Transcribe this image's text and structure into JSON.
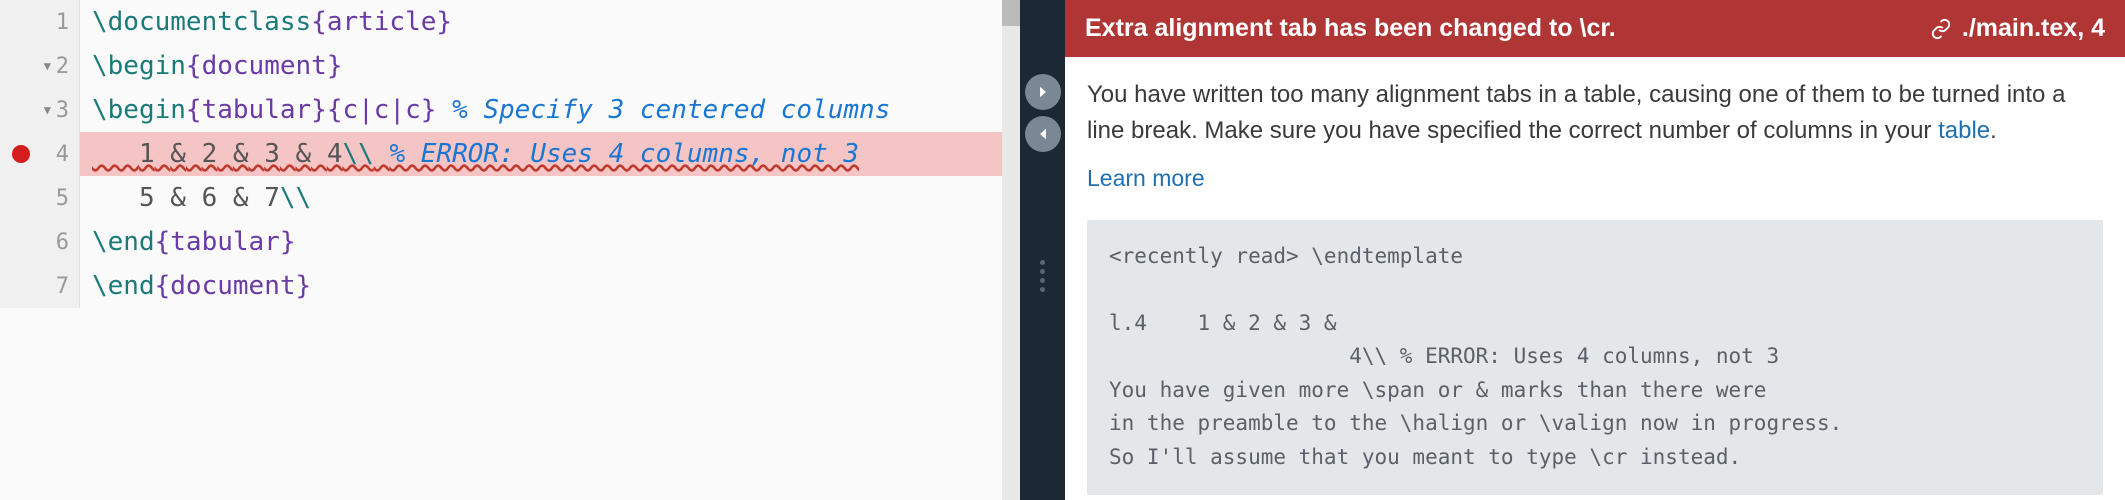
{
  "editor": {
    "lines": [
      {
        "n": "1",
        "fold": false,
        "error": false,
        "highlight": false,
        "tokens": [
          {
            "cls": "tok-cmd",
            "t": "\\documentclass"
          },
          {
            "cls": "tok-brace",
            "t": "{"
          },
          {
            "cls": "tok-arg",
            "t": "article"
          },
          {
            "cls": "tok-brace",
            "t": "}"
          }
        ]
      },
      {
        "n": "2",
        "fold": true,
        "error": false,
        "highlight": false,
        "tokens": [
          {
            "cls": "tok-cmd",
            "t": "\\begin"
          },
          {
            "cls": "tok-brace",
            "t": "{"
          },
          {
            "cls": "tok-arg",
            "t": "document"
          },
          {
            "cls": "tok-brace",
            "t": "}"
          }
        ]
      },
      {
        "n": "3",
        "fold": true,
        "error": false,
        "highlight": false,
        "tokens": [
          {
            "cls": "tok-cmd",
            "t": "\\begin"
          },
          {
            "cls": "tok-brace",
            "t": "{"
          },
          {
            "cls": "tok-arg",
            "t": "tabular"
          },
          {
            "cls": "tok-brace",
            "t": "}"
          },
          {
            "cls": "tok-brace",
            "t": "{"
          },
          {
            "cls": "tok-arg",
            "t": "c|c|c"
          },
          {
            "cls": "tok-brace",
            "t": "}"
          },
          {
            "cls": "",
            "t": " "
          },
          {
            "cls": "tok-comment",
            "t": "% Specify 3 centered columns"
          }
        ]
      },
      {
        "n": "4",
        "fold": false,
        "error": true,
        "highlight": true,
        "tokens": [
          {
            "cls": "",
            "t": "   "
          },
          {
            "cls": "tok-num",
            "t": "1"
          },
          {
            "cls": "",
            "t": " "
          },
          {
            "cls": "tok-amp",
            "t": "&"
          },
          {
            "cls": "",
            "t": " "
          },
          {
            "cls": "tok-num",
            "t": "2"
          },
          {
            "cls": "",
            "t": " "
          },
          {
            "cls": "tok-amp",
            "t": "&"
          },
          {
            "cls": "",
            "t": " "
          },
          {
            "cls": "tok-num",
            "t": "3"
          },
          {
            "cls": "",
            "t": " "
          },
          {
            "cls": "tok-amp",
            "t": "&"
          },
          {
            "cls": "",
            "t": " "
          },
          {
            "cls": "tok-num",
            "t": "4"
          },
          {
            "cls": "tok-cmd",
            "t": "\\\\"
          },
          {
            "cls": "",
            "t": " "
          },
          {
            "cls": "tok-err-comment",
            "t": "% ERROR: Uses 4 columns, not 3"
          }
        ]
      },
      {
        "n": "5",
        "fold": false,
        "error": false,
        "highlight": false,
        "tokens": [
          {
            "cls": "",
            "t": "   "
          },
          {
            "cls": "tok-num",
            "t": "5"
          },
          {
            "cls": "",
            "t": " "
          },
          {
            "cls": "tok-amp",
            "t": "&"
          },
          {
            "cls": "",
            "t": " "
          },
          {
            "cls": "tok-num",
            "t": "6"
          },
          {
            "cls": "",
            "t": " "
          },
          {
            "cls": "tok-amp",
            "t": "&"
          },
          {
            "cls": "",
            "t": " "
          },
          {
            "cls": "tok-num",
            "t": "7"
          },
          {
            "cls": "tok-cmd",
            "t": "\\\\"
          }
        ]
      },
      {
        "n": "6",
        "fold": false,
        "error": false,
        "highlight": false,
        "tokens": [
          {
            "cls": "tok-cmd",
            "t": "\\end"
          },
          {
            "cls": "tok-brace",
            "t": "{"
          },
          {
            "cls": "tok-arg",
            "t": "tabular"
          },
          {
            "cls": "tok-brace",
            "t": "}"
          }
        ]
      },
      {
        "n": "7",
        "fold": false,
        "error": false,
        "highlight": false,
        "tokens": [
          {
            "cls": "tok-cmd",
            "t": "\\end"
          },
          {
            "cls": "tok-brace",
            "t": "{"
          },
          {
            "cls": "tok-arg",
            "t": "document"
          },
          {
            "cls": "tok-brace",
            "t": "}"
          }
        ]
      }
    ]
  },
  "error_panel": {
    "title": "Extra alignment tab has been changed to \\cr.",
    "location": "./main.tex, 4",
    "description_before": "You have written too many alignment tabs in a table, causing one of them to be turned into a line break. Make sure you have specified the correct number of columns in your ",
    "description_link": "table",
    "description_after": ".",
    "learn_more": "Learn more",
    "log": "<recently read> \\endtemplate\n\nl.4    1 & 2 & 3 &\n                   4\\\\ % ERROR: Uses 4 columns, not 3\nYou have given more \\span or & marks than there were\nin the preamble to the \\halign or \\valign now in progress.\nSo I'll assume that you meant to type \\cr instead."
  }
}
